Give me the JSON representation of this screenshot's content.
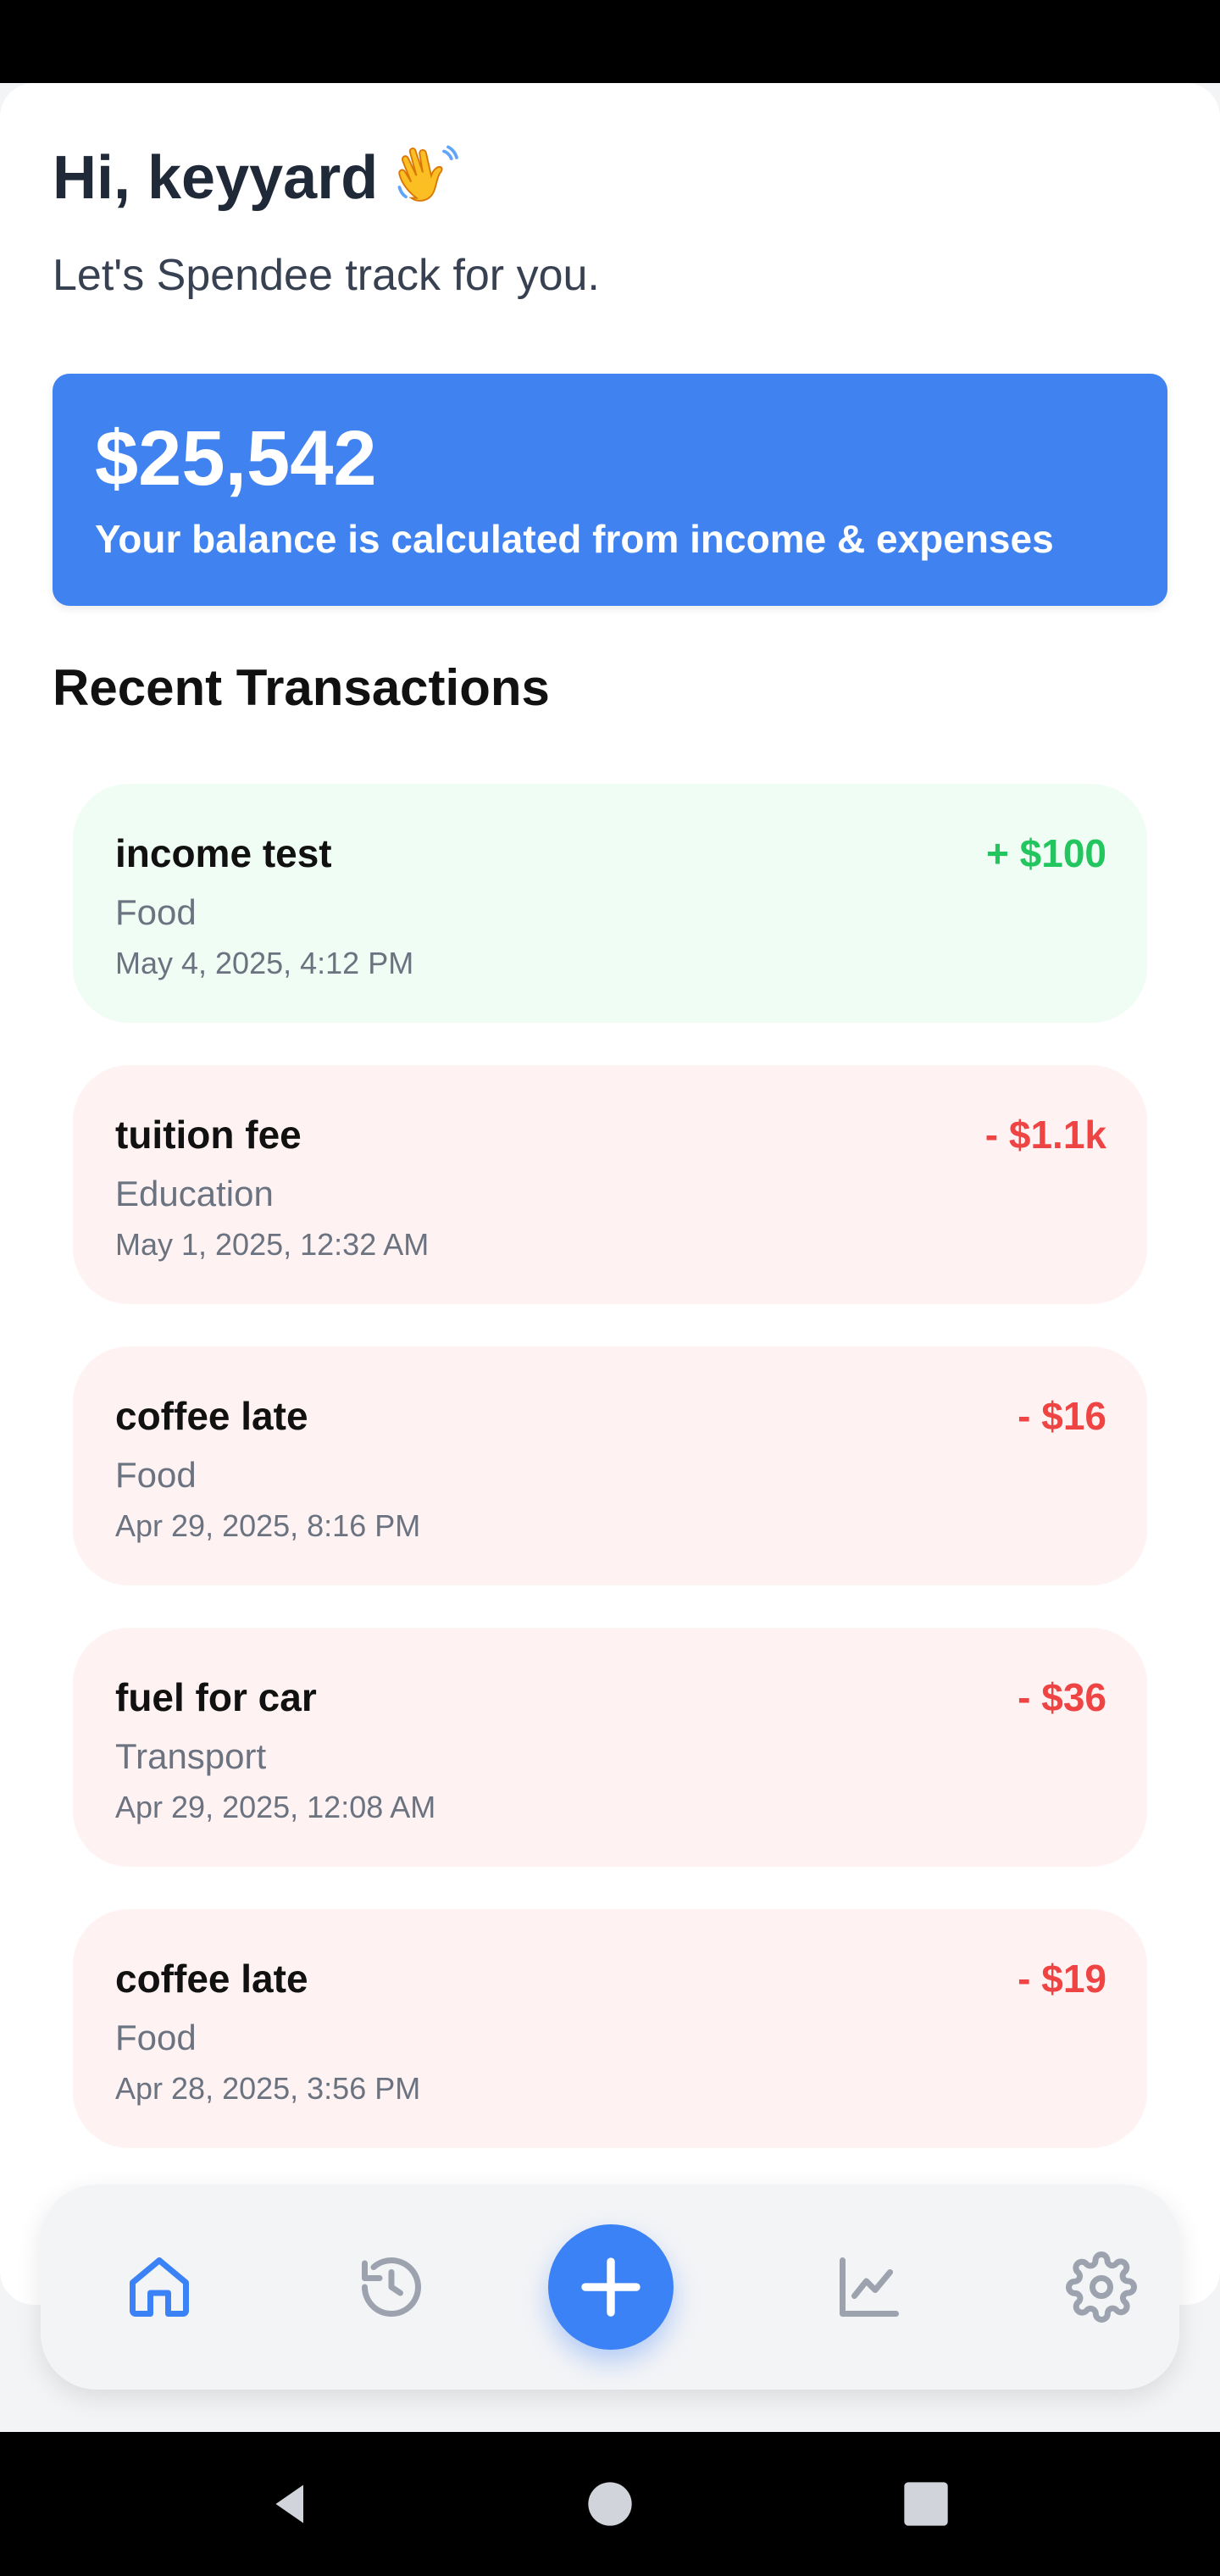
{
  "header": {
    "greeting": "Hi, keyyard",
    "subtitle": "Let's Spendee track for you."
  },
  "balance": {
    "amount": "$25,542",
    "note": "Your balance is calculated from income & expenses"
  },
  "recent": {
    "title": "Recent Transactions",
    "items": [
      {
        "title": "income test",
        "category": "Food",
        "date": "May 4, 2025, 4:12 PM",
        "amount": "+ $100",
        "type": "income"
      },
      {
        "title": "tuition fee",
        "category": "Education",
        "date": "May 1, 2025, 12:32 AM",
        "amount": "- $1.1k",
        "type": "expense"
      },
      {
        "title": "coffee late",
        "category": "Food",
        "date": "Apr 29, 2025, 8:16 PM",
        "amount": "- $16",
        "type": "expense"
      },
      {
        "title": "fuel for car",
        "category": "Transport",
        "date": "Apr 29, 2025, 12:08 AM",
        "amount": "- $36",
        "type": "expense"
      },
      {
        "title": "coffee late",
        "category": "Food",
        "date": "Apr 28, 2025, 3:56 PM",
        "amount": "- $19",
        "type": "expense"
      }
    ]
  },
  "nav": {
    "items": [
      "home-icon",
      "history-icon",
      "add-icon",
      "chart-icon",
      "settings-icon"
    ],
    "active": "home-icon"
  },
  "colors": {
    "accent": "#3b82f6",
    "income": "#22c55e",
    "expense": "#ef4444"
  }
}
